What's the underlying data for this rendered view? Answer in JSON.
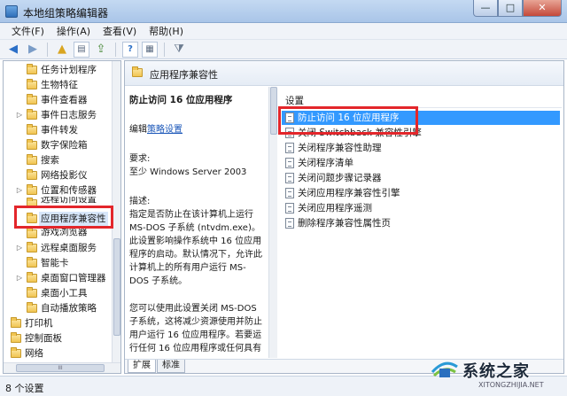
{
  "window": {
    "title": "本地组策略编辑器",
    "buttons": {
      "minimize": "—",
      "maximize": "□",
      "close": "✕"
    }
  },
  "menu": [
    "文件(F)",
    "操作(A)",
    "查看(V)",
    "帮助(H)"
  ],
  "toolbar": {
    "back": "◀",
    "forward": "▶",
    "up_folder": "▲",
    "show_hide": "▤",
    "export": "⇪",
    "help": "?",
    "properties": "▦",
    "filter": "⧩"
  },
  "tree": {
    "items": [
      {
        "label": "任务计划程序",
        "arrow": ""
      },
      {
        "label": "生物特征",
        "arrow": ""
      },
      {
        "label": "事件查看器",
        "arrow": ""
      },
      {
        "label": "事件日志服务",
        "arrow": "▷"
      },
      {
        "label": "事件转发",
        "arrow": ""
      },
      {
        "label": "数字保险箱",
        "arrow": ""
      },
      {
        "label": "搜索",
        "arrow": ""
      },
      {
        "label": "网络投影仪",
        "arrow": ""
      },
      {
        "label": "位置和传感器",
        "arrow": "▷"
      },
      {
        "label": "远程访问设置",
        "arrow": ""
      },
      {
        "label": "应用程序兼容性",
        "arrow": ""
      },
      {
        "label": "游戏浏览器",
        "arrow": ""
      },
      {
        "label": "远程桌面服务",
        "arrow": "▷"
      },
      {
        "label": "智能卡",
        "arrow": ""
      },
      {
        "label": "桌面窗口管理器",
        "arrow": "▷"
      },
      {
        "label": "桌面小工具",
        "arrow": ""
      },
      {
        "label": "自动播放策略",
        "arrow": ""
      },
      {
        "label": "打印机",
        "arrow": ""
      },
      {
        "label": "控制面板",
        "arrow": ""
      },
      {
        "label": "网络",
        "arrow": ""
      }
    ],
    "hscroll_label": "III"
  },
  "pane": {
    "header_title": "应用程序兼容性",
    "description": {
      "title": "防止访问 16 位应用程序",
      "edit_prefix": "编辑",
      "edit_link": "策略设置",
      "requirement_label": "要求:",
      "requirement_value": "至少 Windows Server 2003",
      "description_label": "描述:",
      "description_text": "指定是否防止在该计算机上运行 MS-DOS 子系统 (ntvdm.exe)。此设置影响操作系统中 16 位应用程序的启动。默认情况下，允许此计算机上的所有用户运行 MS-DOS 子系统。",
      "description_text2": "您可以使用此设置关闭 MS-DOS 子系统，这将减少资源使用并防止用户运行 16 位应用程序。若要运行任何 16 位应用程序或任何具有"
    },
    "list": {
      "header": "设置",
      "items": [
        "防止访问 16 位应用程序",
        "关闭 Switchback 兼容性引擎",
        "关闭程序兼容性助理",
        "关闭程序清单",
        "关闭问题步骤记录器",
        "关闭应用程序兼容性引擎",
        "关闭应用程序遥测",
        "删除程序兼容性属性页"
      ]
    },
    "tabs": [
      "扩展",
      "标准"
    ]
  },
  "status": {
    "text": "8 个设置"
  },
  "watermark": {
    "text": "系统之家",
    "url": "XITONGZHIJIA.NET"
  },
  "colors": {
    "highlight_box": "#e3262b",
    "selection": "#3399ff",
    "link": "#1a56b8"
  }
}
